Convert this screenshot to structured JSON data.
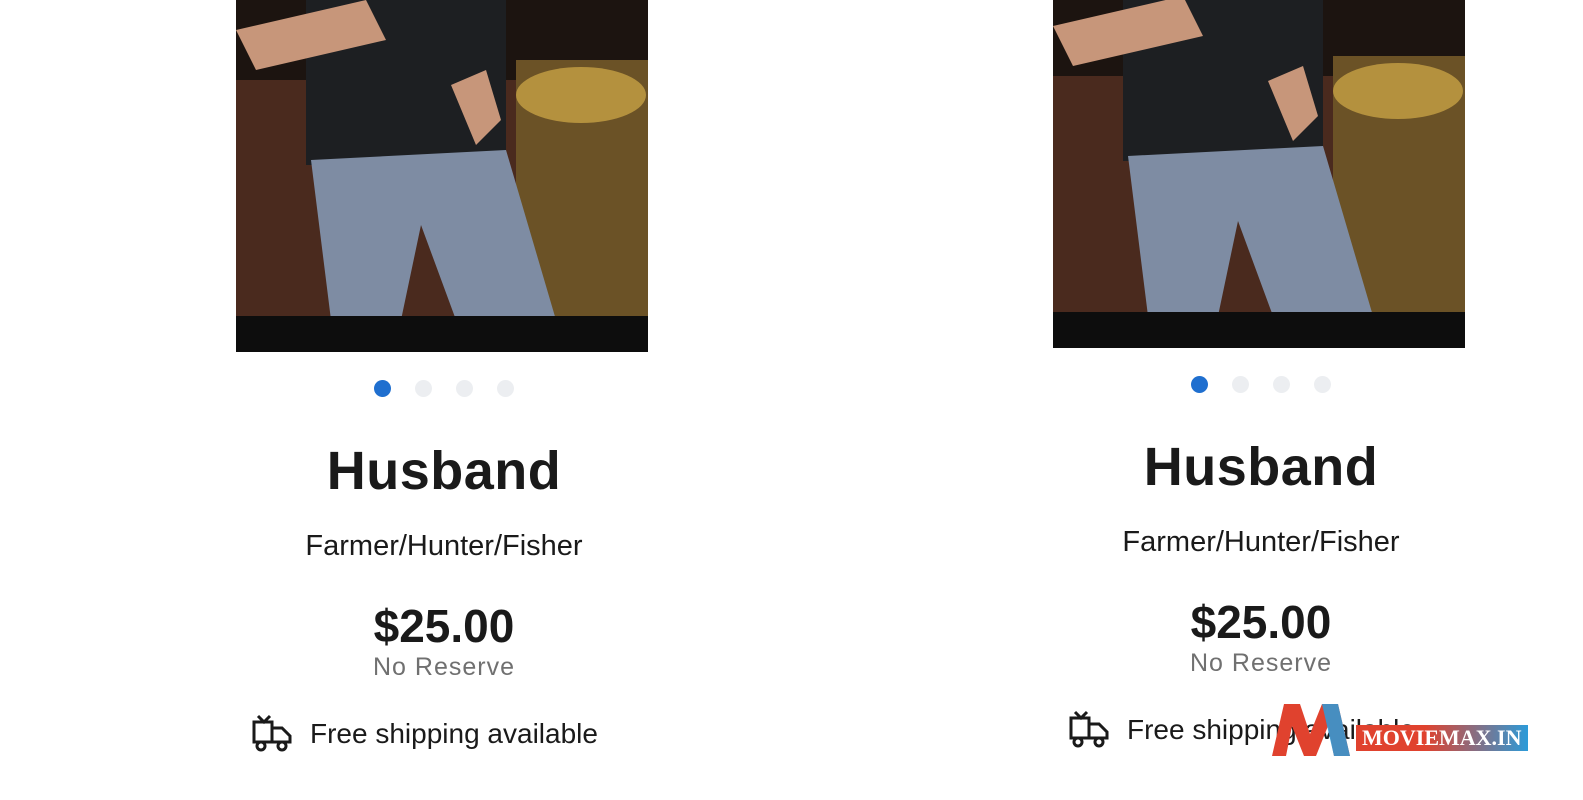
{
  "listings": [
    {
      "title": "Husband",
      "subtitle": "Farmer/Hunter/Fisher",
      "price": "$25.00",
      "reserve": "No Reserve",
      "shipping": "Free shipping available",
      "carousel": {
        "total": 4,
        "active": 1
      }
    },
    {
      "title": "Husband",
      "subtitle": "Farmer/Hunter/Fisher",
      "price": "$25.00",
      "reserve": "No Reserve",
      "shipping": "Free shipping available",
      "carousel": {
        "total": 4,
        "active": 1
      }
    }
  ],
  "watermark": {
    "text": "MOVIEMAX.IN"
  },
  "colors": {
    "carousel_active": "#1f6fcf",
    "carousel_inactive": "#eceef1",
    "watermark_red": "#e0422e",
    "watermark_blue": "#2c9bd9"
  },
  "icons": {
    "shipping": "delivery-truck-icon"
  }
}
